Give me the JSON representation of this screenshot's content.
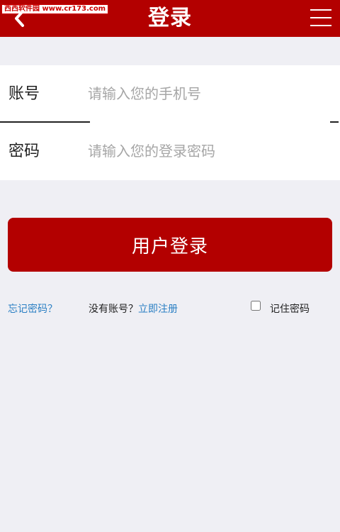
{
  "watermark": "西西软件园 www.cr173.com",
  "header": {
    "title": "登录",
    "back_icon": "chevron-left-icon",
    "menu_icon": "hamburger-menu-icon",
    "background": "#b30000"
  },
  "form": {
    "account": {
      "label": "账号",
      "placeholder": "请输入您的手机号",
      "value": ""
    },
    "password": {
      "label": "密码",
      "placeholder": "请输入您的登录密码",
      "value": ""
    }
  },
  "login_button": {
    "label": "用户登录",
    "color": "#b30000"
  },
  "links": {
    "forgot_password": "忘记密码？",
    "no_account_text": "没有账号？",
    "register": "立即注册",
    "remember_password": "记住密码",
    "remember_checked": false,
    "link_color": "#2a7fc3"
  }
}
